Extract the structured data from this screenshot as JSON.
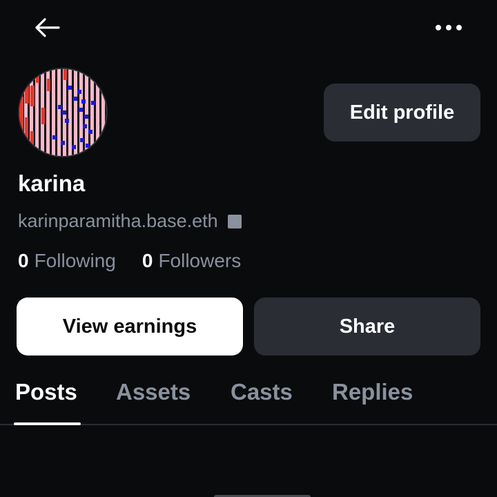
{
  "header": {
    "back_icon": "arrow-left-icon",
    "more_icon": "more-horizontal-icon"
  },
  "profile": {
    "avatar_icon": "nft-avatar",
    "display_name": "karina",
    "handle": "karinparamitha.base.eth",
    "following_count": "0",
    "following_label": "Following",
    "followers_count": "0",
    "followers_label": "Followers"
  },
  "actions": {
    "edit_profile_label": "Edit profile",
    "view_earnings_label": "View earnings",
    "share_label": "Share"
  },
  "tabs": [
    {
      "label": "Posts",
      "active": true
    },
    {
      "label": "Assets",
      "active": false
    },
    {
      "label": "Casts",
      "active": false
    },
    {
      "label": "Replies",
      "active": false
    }
  ],
  "colors": {
    "background": "#0a0b0d",
    "muted_text": "#8a919e",
    "secondary_button": "#2a2d34",
    "primary_button": "#ffffff",
    "avatar_pink": "#f4b9c9",
    "avatar_red": "#e03a2a",
    "avatar_blue": "#1a1ad8"
  }
}
